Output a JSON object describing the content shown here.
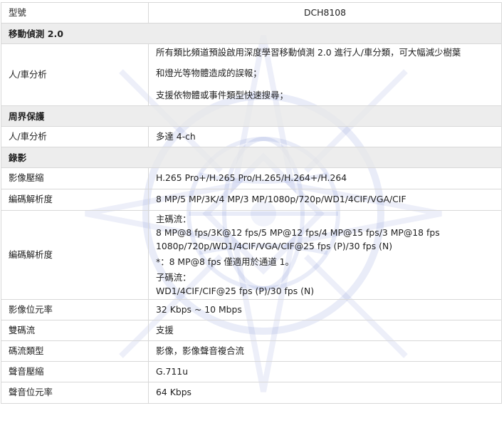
{
  "header": {
    "label": "型號",
    "model": "DCH8108"
  },
  "sections": {
    "motion": "移動偵測 2.0",
    "perimeter": "周界保護",
    "recording": "錄影"
  },
  "motion_rows": {
    "human_vehicle": {
      "label": "人/車分析",
      "line1": "所有類比頻道預設啟用深度學習移動偵測 2.0 進行人/車分類，可大幅減少樹葉",
      "line2": "和燈光等物體造成的誤報；",
      "line3": "支援依物體或事件類型快速搜尋；"
    }
  },
  "perimeter_rows": {
    "human_vehicle": {
      "label": "人/車分析",
      "value": "多達 4-ch"
    }
  },
  "recording_rows": {
    "compression": {
      "label": "影像壓縮",
      "value": "H.265 Pro+/H.265 Pro/H.265/H.264+/H.264"
    },
    "encoding_resolution": {
      "label": "編碼解析度",
      "value": "8 MP/5 MP/3K/4 MP/3 MP/1080p/720p/WD1/4CIF/VGA/CIF"
    },
    "encoding_framerate": {
      "label": "編碼解析度",
      "main_title": "主碼流：",
      "main_line1": "8 MP@8 fps/3K@12 fps/5 MP@12 fps/4 MP@15 fps/3 MP@18 fps",
      "main_line2": "1080p/720p/WD1/4CIF/VGA/CIF@25 fps (P)/30 fps (N)",
      "note": "*：8 MP@8 fps 僅適用於通道 1。",
      "sub_title": "子碼流：",
      "sub_line1": "WD1/4CIF/CIF@25 fps (P)/30 fps (N)"
    },
    "video_bitrate": {
      "label": "影像位元率",
      "value": "32 Kbps ~ 10 Mbps"
    },
    "dual_stream": {
      "label": "雙碼流",
      "value": "支援"
    },
    "stream_type": {
      "label": "碼流類型",
      "value": "影像，影像聲音複合流"
    },
    "audio_compression": {
      "label": "聲音壓縮",
      "value": "G.711u"
    },
    "audio_bitrate": {
      "label": "聲音位元率",
      "value": "64 Kbps"
    }
  },
  "colors": {
    "section_bg": "#e8e8e8",
    "border": "#d8d8d8",
    "text": "#222222",
    "watermark": "#4a63c9"
  },
  "icons": {
    "watermark": "compass-globe-watermark-icon"
  }
}
